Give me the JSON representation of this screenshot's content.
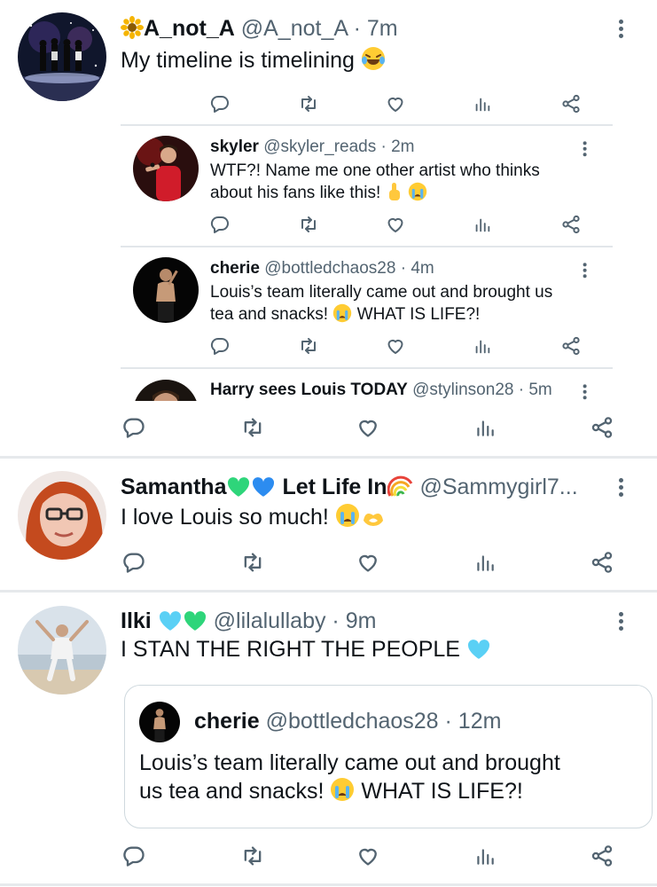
{
  "thread": {
    "main": {
      "name": "A_not_A",
      "handle": "@A_not_A",
      "time": "· 7m",
      "text": "My timeline is timelining"
    },
    "replies": [
      {
        "name": "skyler",
        "handle": "@skyler_reads · 2m",
        "line1": "WTF?! Name me one other artist who thinks",
        "line2": "about his fans like this!"
      },
      {
        "name": "cherie",
        "handle": "@bottledchaos28 · 4m",
        "line1": "Louis’s team literally came out and brought us",
        "line2": "tea and snacks!",
        "line2b": "WHAT IS LIFE?!"
      },
      {
        "name": "Harry sees Louis TODAY",
        "handle": "@stylinson28 · 5m"
      }
    ]
  },
  "tweet2": {
    "name": "Samantha",
    "name2": "Let Life In",
    "handle": "@Sammygirl7...",
    "text": "I love Louis so much!"
  },
  "tweet3": {
    "name": "Ilki",
    "handle": "@lilalullaby · 9m",
    "text": "I STAN THE RIGHT THE PEOPLE",
    "quote": {
      "name": "cherie",
      "handle": "@bottledchaos28 · 12m",
      "line1": "Louis’s team literally came out and brought",
      "line2": "us tea and snacks!",
      "line2b": "WHAT IS LIFE?!"
    }
  },
  "colors": {
    "text": "#0f1419",
    "secondary": "#536471",
    "divider": "#e6e9ec",
    "border": "#cfd9de"
  },
  "icons": [
    "reply-icon",
    "retweet-icon",
    "like-icon",
    "analytics-icon",
    "share-icon",
    "more-icon"
  ]
}
